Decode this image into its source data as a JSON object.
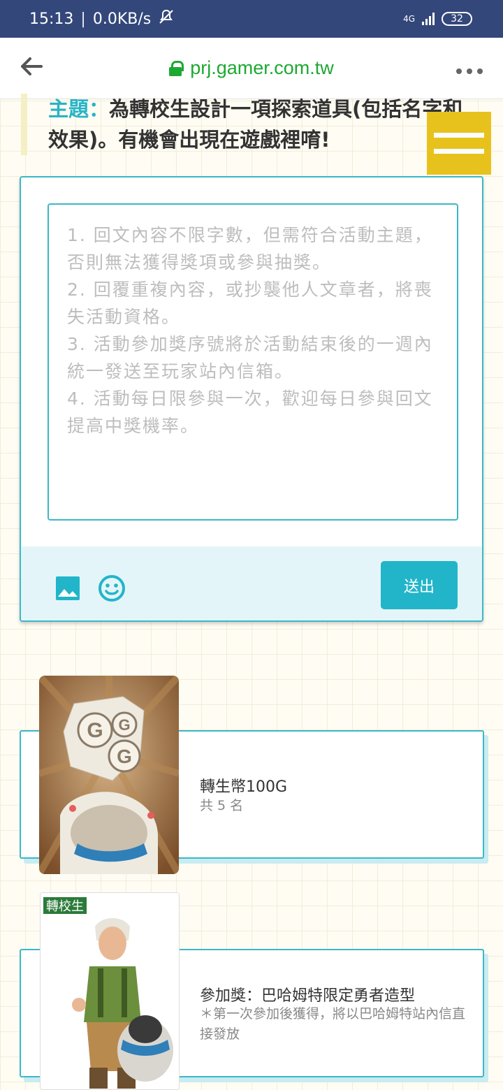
{
  "status_bar": {
    "time": "15:13",
    "separator": "|",
    "net_speed": "0.0KB/s",
    "network": "4G",
    "battery": "32"
  },
  "url_bar": {
    "url": "prj.gamer.com.tw"
  },
  "topic": {
    "label": "主題：",
    "text": "為轉校生設計一項探索道具(包括名字和效果)。有機會出現在遊戲裡唷!"
  },
  "reply": {
    "placeholder": "1. 回文內容不限字數，但需符合活動主題，否則無法獲得獎項或參與抽獎。\n2. 回覆重複內容，或抄襲他人文章者，將喪失活動資格。\n3. 活動參加獎序號將於活動結束後的一週內統一發送至玩家站內信箱。\n4. 活動每日限參與一次，歡迎每日參與回文提高中獎機率。",
    "send_label": "送出"
  },
  "prizes": [
    {
      "title": "轉生幣100G",
      "subtitle": "共 5 名"
    },
    {
      "title": "參加獎：巴哈姆特限定勇者造型",
      "subtitle": "＊第一次參加後獲得，將以巴哈姆特站內信直接發放",
      "logo_text": "轉校生"
    }
  ]
}
